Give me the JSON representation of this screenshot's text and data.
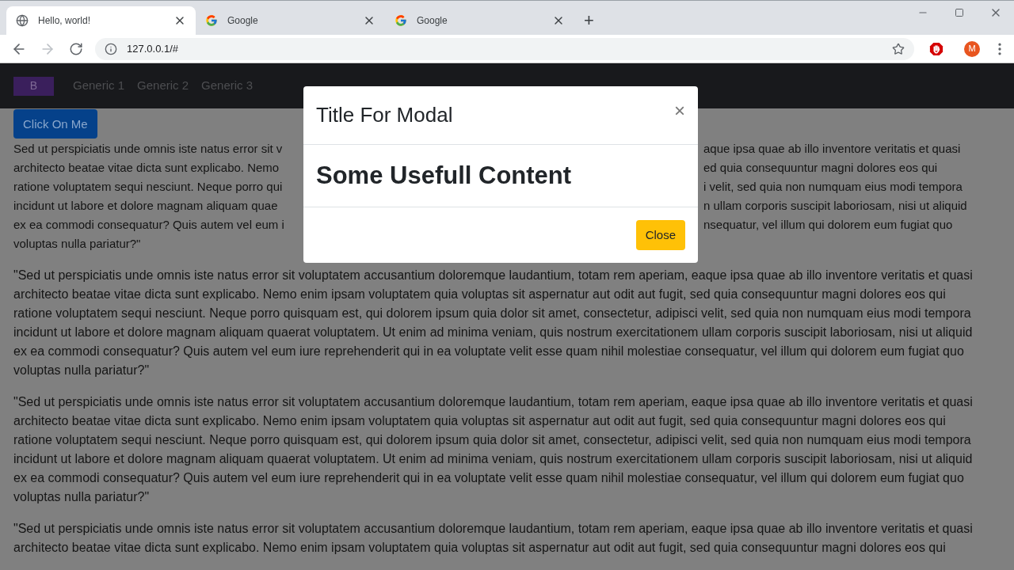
{
  "browser": {
    "tabs": [
      {
        "title": "Hello, world!",
        "selected": true,
        "kind": "globe"
      },
      {
        "title": "Google",
        "selected": false,
        "kind": "google"
      },
      {
        "title": "Google",
        "selected": false,
        "kind": "google"
      }
    ],
    "new_tab": "+",
    "address": "127.0.0.1/#",
    "forward_disabled": true,
    "profile_initial": "M"
  },
  "navbar": {
    "brand": "B",
    "links": [
      "Generic 1",
      "Generic 2",
      "Generic 3"
    ]
  },
  "page": {
    "button": "Click On Me",
    "first_paragraph_lines": [
      {
        "left": "Sed ut perspiciatis unde omnis iste natus error sit v",
        "right": "aque ipsa quae ab illo inventore veritatis et quasi"
      },
      {
        "left": "architecto beatae vitae dicta sunt explicabo. Nemo",
        "right": "ed quia consequuntur magni dolores eos qui"
      },
      {
        "left": "ratione voluptatem sequi nesciunt. Neque porro qui",
        "right": "i velit, sed quia non numquam eius modi tempora"
      },
      {
        "left": "incidunt ut labore et dolore magnam aliquam quae",
        "right": "n ullam corporis suscipit laboriosam, nisi ut aliquid"
      },
      {
        "left": "ex ea commodi consequatur? Quis autem vel eum i",
        "right": "nsequatur, vel illum qui dolorem eum fugiat quo"
      },
      {
        "left": "voluptas nulla pariatur?\""
      }
    ],
    "paragraphs": [
      "\"Sed ut perspiciatis unde omnis iste natus error sit voluptatem accusantium doloremque laudantium, totam rem aperiam, eaque ipsa quae ab illo inventore veritatis et quasi architecto beatae vitae dicta sunt explicabo. Nemo enim ipsam voluptatem quia voluptas sit aspernatur aut odit aut fugit, sed quia consequuntur magni dolores eos qui ratione voluptatem sequi nesciunt. Neque porro quisquam est, qui dolorem ipsum quia dolor sit amet, consectetur, adipisci velit, sed quia non numquam eius modi tempora incidunt ut labore et dolore magnam aliquam quaerat voluptatem. Ut enim ad minima veniam, quis nostrum exercitationem ullam corporis suscipit laboriosam, nisi ut aliquid ex ea commodi consequatur? Quis autem vel eum iure reprehenderit qui in ea voluptate velit esse quam nihil molestiae consequatur, vel illum qui dolorem eum fugiat quo voluptas nulla pariatur?\"",
      "\"Sed ut perspiciatis unde omnis iste natus error sit voluptatem accusantium doloremque laudantium, totam rem aperiam, eaque ipsa quae ab illo inventore veritatis et quasi architecto beatae vitae dicta sunt explicabo. Nemo enim ipsam voluptatem quia voluptas sit aspernatur aut odit aut fugit, sed quia consequuntur magni dolores eos qui ratione voluptatem sequi nesciunt. Neque porro quisquam est, qui dolorem ipsum quia dolor sit amet, consectetur, adipisci velit, sed quia non numquam eius modi tempora incidunt ut labore et dolore magnam aliquam quaerat voluptatem. Ut enim ad minima veniam, quis nostrum exercitationem ullam corporis suscipit laboriosam, nisi ut aliquid ex ea commodi consequatur? Quis autem vel eum iure reprehenderit qui in ea voluptate velit esse quam nihil molestiae consequatur, vel illum qui dolorem eum fugiat quo voluptas nulla pariatur?\""
    ],
    "last_paragraph_lines": [
      "\"Sed ut perspiciatis unde omnis iste natus error sit voluptatem accusantium doloremque laudantium, totam rem aperiam, eaque ipsa quae ab illo inventore veritatis et quasi",
      "architecto beatae vitae dicta sunt explicabo. Nemo enim ipsam voluptatem quia voluptas sit aspernatur aut odit aut fugit, sed quia consequuntur magni dolores eos qui"
    ]
  },
  "modal": {
    "title": "Title For Modal",
    "close_symbol": "×",
    "body": "Some Usefull Content",
    "button": "Close"
  }
}
